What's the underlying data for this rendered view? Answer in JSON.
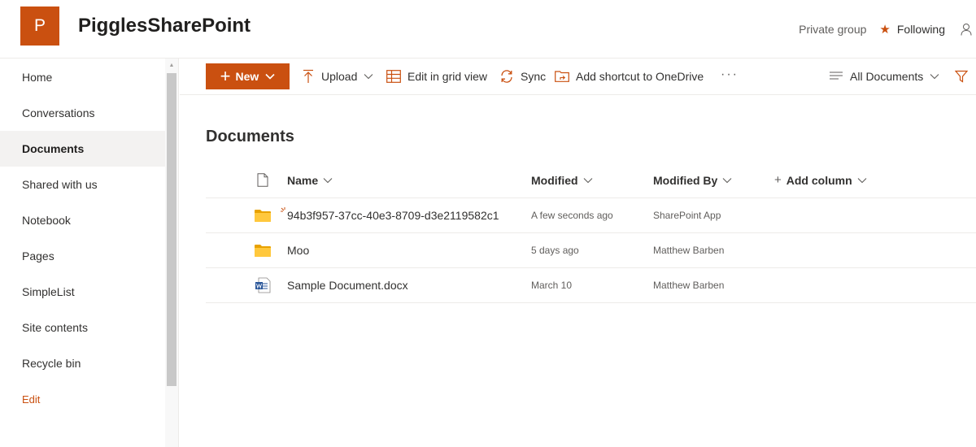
{
  "header": {
    "logo_letter": "P",
    "site_title": "PigglesSharePoint",
    "private_group": "Private group",
    "following": "Following"
  },
  "nav": {
    "items": [
      {
        "label": "Home"
      },
      {
        "label": "Conversations"
      },
      {
        "label": "Documents"
      },
      {
        "label": "Shared with us"
      },
      {
        "label": "Notebook"
      },
      {
        "label": "Pages"
      },
      {
        "label": "SimpleList"
      },
      {
        "label": "Site contents"
      },
      {
        "label": "Recycle bin"
      }
    ],
    "selected": "Documents",
    "edit": "Edit"
  },
  "commandbar": {
    "new": "New",
    "upload": "Upload",
    "edit_grid": "Edit in grid view",
    "sync": "Sync",
    "add_shortcut": "Add shortcut to OneDrive",
    "more": "···",
    "view": "All Documents"
  },
  "library": {
    "title": "Documents",
    "columns": {
      "name": "Name",
      "modified": "Modified",
      "modified_by": "Modified By",
      "add_column": "Add column"
    },
    "rows": [
      {
        "type": "folder",
        "name": "94b3f957-37cc-40e3-8709-d3e2119582c1",
        "modified": "A few seconds ago",
        "modified_by": "SharePoint App",
        "is_new": true
      },
      {
        "type": "folder",
        "name": "Moo",
        "modified": "5 days ago",
        "modified_by": "Matthew Barben",
        "is_new": false
      },
      {
        "type": "word",
        "name": "Sample Document.docx",
        "modified": "March 10",
        "modified_by": "Matthew Barben",
        "is_new": false
      }
    ]
  },
  "colors": {
    "accent": "#ca5010",
    "folder": "#ffb900",
    "word": "#2b579a"
  }
}
